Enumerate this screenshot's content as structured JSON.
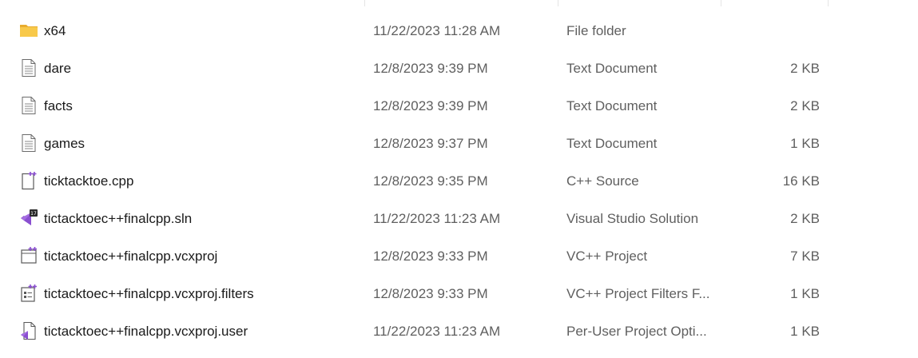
{
  "files": [
    {
      "name": "x64",
      "date": "11/22/2023 11:28 AM",
      "type": "File folder",
      "size": "",
      "icon": "folder-icon"
    },
    {
      "name": "dare",
      "date": "12/8/2023 9:39 PM",
      "type": "Text Document",
      "size": "2 KB",
      "icon": "text-document-icon"
    },
    {
      "name": "facts",
      "date": "12/8/2023 9:39 PM",
      "type": "Text Document",
      "size": "2 KB",
      "icon": "text-document-icon"
    },
    {
      "name": "games",
      "date": "12/8/2023 9:37 PM",
      "type": "Text Document",
      "size": "1 KB",
      "icon": "text-document-icon"
    },
    {
      "name": "ticktacktoe.cpp",
      "date": "12/8/2023 9:35 PM",
      "type": "C++ Source",
      "size": "16 KB",
      "icon": "cpp-source-icon"
    },
    {
      "name": "tictacktoec++finalcpp.sln",
      "date": "11/22/2023 11:23 AM",
      "type": "Visual Studio Solution",
      "size": "2 KB",
      "icon": "visual-studio-solution-icon"
    },
    {
      "name": "tictacktoec++finalcpp.vcxproj",
      "date": "12/8/2023 9:33 PM",
      "type": "VC++ Project",
      "size": "7 KB",
      "icon": "vc-project-icon"
    },
    {
      "name": "tictacktoec++finalcpp.vcxproj.filters",
      "date": "12/8/2023 9:33 PM",
      "type": "VC++ Project Filters F...",
      "size": "1 KB",
      "icon": "vc-project-filters-icon"
    },
    {
      "name": "tictacktoec++finalcpp.vcxproj.user",
      "date": "11/22/2023 11:23 AM",
      "type": "Per-User Project Opti...",
      "size": "1 KB",
      "icon": "per-user-project-options-icon"
    }
  ],
  "colors": {
    "folder": "#f8c94a",
    "visual_studio_purple": "#8a4fd0",
    "document_outline": "#5a5a5a"
  }
}
